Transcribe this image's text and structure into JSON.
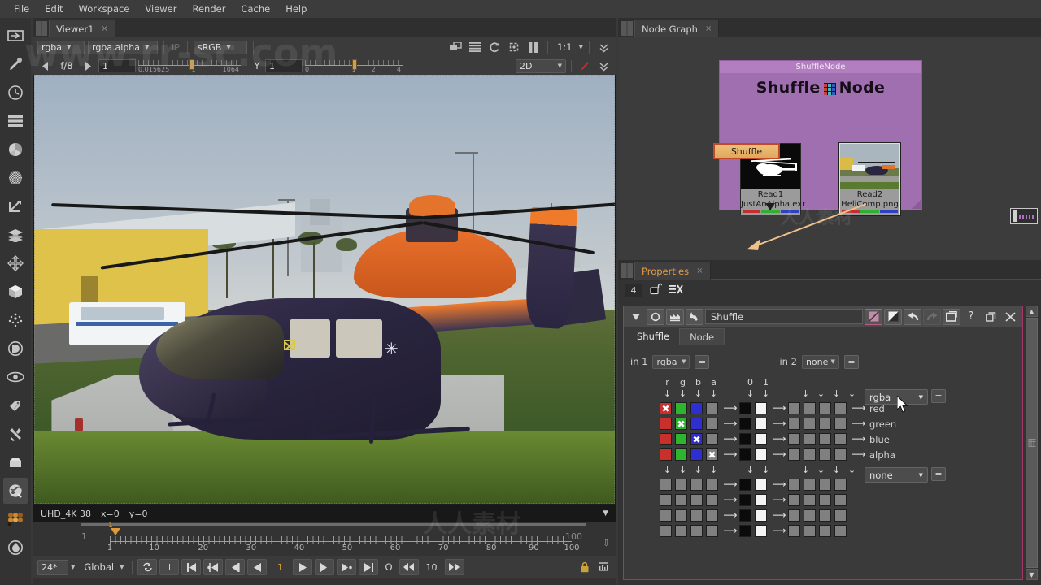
{
  "menu": {
    "items": [
      "File",
      "Edit",
      "Workspace",
      "Viewer",
      "Render",
      "Cache",
      "Help"
    ]
  },
  "left_toolbar": {
    "items": [
      {
        "name": "image-icon",
        "label": "Image"
      },
      {
        "name": "draw-icon",
        "label": "Draw"
      },
      {
        "name": "time-icon",
        "label": "Time"
      },
      {
        "name": "channel-icon",
        "label": "Channel"
      },
      {
        "name": "color-icon",
        "label": "Color"
      },
      {
        "name": "filter-icon",
        "label": "Filter"
      },
      {
        "name": "keyer-icon",
        "label": "Keyer"
      },
      {
        "name": "merge-icon",
        "label": "Merge"
      },
      {
        "name": "transform-icon",
        "label": "Transform"
      },
      {
        "name": "3d-icon",
        "label": "3D"
      },
      {
        "name": "particles-icon",
        "label": "Particles"
      },
      {
        "name": "deep-icon",
        "label": "Deep"
      },
      {
        "name": "views-icon",
        "label": "Views"
      },
      {
        "name": "metadata-icon",
        "label": "Metadata"
      },
      {
        "name": "other-icon",
        "label": "Other"
      },
      {
        "name": "toolsets-icon",
        "label": "ToolSets"
      },
      {
        "name": "plugins-icon",
        "label": "Plugins"
      },
      {
        "name": "nukepedia-icon",
        "label": "Nukepedia"
      },
      {
        "name": "furnace-icon",
        "label": "Furnace"
      }
    ]
  },
  "viewer": {
    "tab_label": "Viewer1",
    "tab_close": "×",
    "channel_select": "rgba",
    "layer_select": "rgba.alpha",
    "ip_label": "IP",
    "colorspace_select": "sRGB",
    "zoom_level": "1:1",
    "mode_select": "2D",
    "gain_label": "f/8",
    "gain_value": "1",
    "gain_scale_min": "0.015625",
    "gain_scale_mid": "1",
    "gain_scale_max": "1064",
    "gamma_label": "Y",
    "gamma_value": "1",
    "gamma_scale": [
      "0",
      "1",
      "2",
      "4"
    ],
    "status_format": "UHD_4K 38",
    "status_x": "x=0",
    "status_y": "y=0",
    "icons": [
      "proxy-icon",
      "list-icon",
      "refresh-icon",
      "roi-icon",
      "pause-icon"
    ]
  },
  "timeline": {
    "start_frame": "1",
    "end_frame": "100",
    "current_frame": "1",
    "playhead_label": "1",
    "tick_labels": [
      "1",
      "10",
      "20",
      "30",
      "40",
      "50",
      "60",
      "70",
      "80",
      "90",
      "100"
    ],
    "fps": "24*",
    "sync_select": "Global",
    "frame_field": "1",
    "increment_field": "10",
    "key_label": "I",
    "o_label": "O",
    "buttons": [
      "loop-icon",
      "in-point-icon",
      "first-frame-icon",
      "prev-key-icon",
      "prev-frame-icon",
      "play-backward-icon",
      "play-forward-icon",
      "next-frame-icon",
      "next-key-icon",
      "last-frame-icon"
    ]
  },
  "node_graph": {
    "tab_label": "Node Graph",
    "tab_close": "×",
    "backdrop_title": "ShuffleNode",
    "backdrop_label_a": "Shuffle",
    "backdrop_label_b": "Node",
    "nodes": [
      {
        "name": "Read1",
        "file": "JustAnAlpha.exr"
      },
      {
        "name": "Read2",
        "file": "HeliComp.png"
      }
    ],
    "shuffle_node_label": "Shuffle"
  },
  "properties": {
    "tab_label": "Properties",
    "tab_close": "×",
    "pin_count": "4",
    "node_name": "Shuffle",
    "tabs": [
      {
        "label": "Shuffle",
        "active": true
      },
      {
        "label": "Node",
        "active": false
      }
    ],
    "header_icons": [
      "collapse-icon",
      "viewer-target-icon",
      "mask-icon",
      "wrench-icon",
      "disable-icon",
      "bypass-icon",
      "undo-icon",
      "redo-icon",
      "duplicate-icon",
      "help-icon",
      "float-icon",
      "close-icon"
    ],
    "in1_label": "in 1",
    "in1_value": "rgba",
    "in2_label": "in 2",
    "in2_value": "none",
    "eq_label": "=",
    "out1_value": "rgba",
    "out2_value": "none",
    "column_headers": [
      "r",
      "g",
      "b",
      "a",
      "0",
      "1"
    ],
    "row_labels": [
      "red",
      "green",
      "blue",
      "alpha"
    ],
    "matrix_top": [
      {
        "row": "red",
        "in1": [
          "red-x",
          "green",
          "blue",
          "grey"
        ],
        "const": [
          "black",
          "white"
        ],
        "in2": [
          "grey",
          "grey",
          "grey",
          "grey"
        ]
      },
      {
        "row": "green",
        "in1": [
          "red",
          "green-x",
          "blue",
          "grey"
        ],
        "const": [
          "black",
          "white"
        ],
        "in2": [
          "grey",
          "grey",
          "grey",
          "grey"
        ]
      },
      {
        "row": "blue",
        "in1": [
          "red",
          "green",
          "blue-x",
          "grey"
        ],
        "const": [
          "black",
          "white"
        ],
        "in2": [
          "grey",
          "grey",
          "grey",
          "grey"
        ]
      },
      {
        "row": "alpha",
        "in1": [
          "red",
          "green",
          "blue",
          "grey-x"
        ],
        "const": [
          "black",
          "white"
        ],
        "in2": [
          "grey",
          "grey",
          "grey",
          "grey"
        ]
      }
    ],
    "matrix_bottom_rows": 4
  },
  "watermarks": {
    "main": "www.rr-sc.com",
    "secondary": "人人素材"
  },
  "colors": {
    "accent_orange": "#e39b4e",
    "backdrop_purple": "#a06fb0",
    "panel_border_pink": "#a8356a",
    "node_orange": "#e0a85e",
    "red": "#c9302c",
    "green": "#2db52d",
    "blue": "#2f2fd0"
  }
}
